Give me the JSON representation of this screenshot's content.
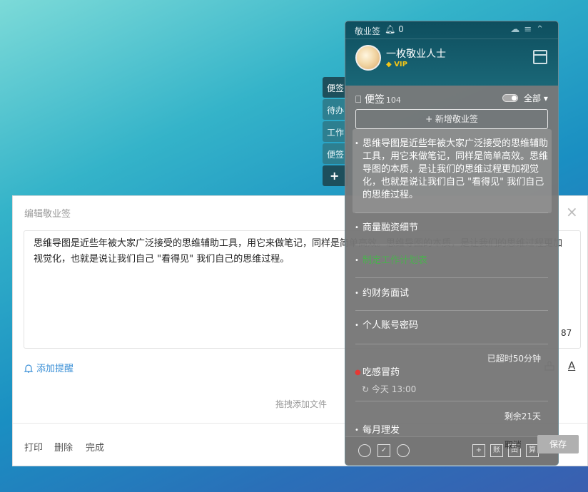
{
  "side_tabs": [
    "便签",
    "待办",
    "工作",
    "便签",
    "+"
  ],
  "editor": {
    "title": "编辑敬业签",
    "content": "思维导图是近些年被大家广泛接受的思维辅助工具，用它来做笔记，同样是简单高效。思维导图的本质，是让我们的思维过程更加视觉化，也就是说让我们自己 \"看得见\" 我们自己的思维过程。",
    "char_count": "87",
    "remind_label": "添加提醒",
    "drop_hint": "拖拽添加文件",
    "footer": {
      "print": "打印",
      "delete": "删除",
      "done": "完成"
    },
    "cancel": "取消",
    "save": "保存"
  },
  "panel": {
    "app_name": "敬业签",
    "bell_count": "0",
    "username": "一枚敬业人士",
    "vip_label": "VIP",
    "section_title": "便签",
    "section_count": "104",
    "filter": "全部",
    "new_button": "+ 新增敬业签",
    "notes": [
      {
        "text": "思维导图是近些年被大家广泛接受的思维辅助工具，用它来做笔记，同样是简单高效。思维导图的本质，是让我们的思维过程更加视觉化，也就是说让我们自己 \"看得见\" 我们自己的思维过程。"
      },
      {
        "text": "商量融资细节"
      },
      {
        "text": "制定工作计划表"
      },
      {
        "text": "约财务面试"
      },
      {
        "text": "个人账号密码"
      },
      {
        "meta": "已超时50分钟",
        "text": "吃感冒药",
        "sub": "今天 13:00"
      },
      {
        "meta": "剩余21天",
        "text": "每月理发"
      }
    ],
    "footer_icons": [
      "clock-icon",
      "todo-icon",
      "search-icon",
      "add-icon",
      "ledger-icon",
      "calendar-icon",
      "calculator-icon"
    ],
    "footer_labels": [
      "+",
      "账",
      "田",
      "算"
    ]
  },
  "colors": {
    "accent": "#3a8fd6",
    "panel_header": "#0e4e5e",
    "done_green": "#4caf50",
    "alert_red": "#e53935"
  }
}
